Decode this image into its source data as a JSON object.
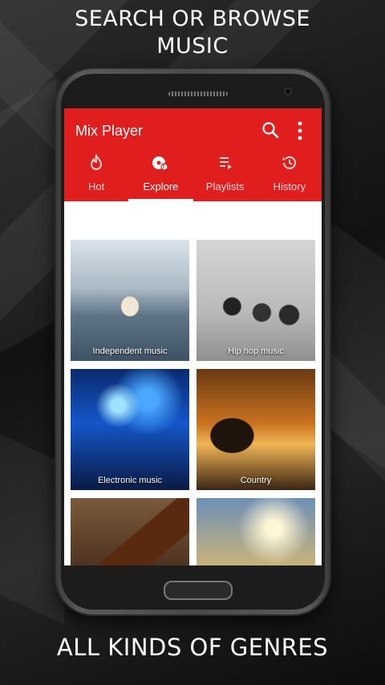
{
  "promo": {
    "top_line1": "SEARCH OR BROWSE",
    "top_line2": "MUSIC",
    "bottom_line": "ALL KINDS OF GENRES"
  },
  "appbar": {
    "title": "Mix Player",
    "color": "#e01e1e",
    "icons": [
      "search-icon",
      "more-vert-icon"
    ]
  },
  "tabs": [
    {
      "label": "Hot",
      "icon": "flame-icon",
      "active": false
    },
    {
      "label": "Explore",
      "icon": "music-disc-icon",
      "active": true
    },
    {
      "label": "Playlists",
      "icon": "playlist-icon",
      "active": false
    },
    {
      "label": "History",
      "icon": "history-icon",
      "active": false
    }
  ],
  "genres": [
    {
      "label": "Independent music"
    },
    {
      "label": "Hip hop music"
    },
    {
      "label": "Electronic music"
    },
    {
      "label": "Country"
    },
    {
      "label": ""
    },
    {
      "label": ""
    }
  ]
}
